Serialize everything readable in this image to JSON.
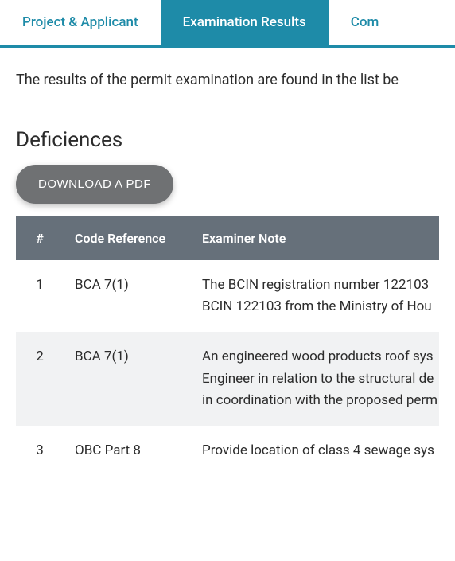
{
  "tabs": {
    "items": [
      {
        "label": "Project & Applicant",
        "active": false
      },
      {
        "label": "Examination Results",
        "active": true
      },
      {
        "label": "Com",
        "active": false
      }
    ]
  },
  "intro_text": "The results of the permit examination are found in the list be",
  "section_title": "Deficiences",
  "download_button_label": "DOWNLOAD A PDF",
  "table": {
    "headers": {
      "num": "#",
      "code": "Code Reference",
      "note": "Examiner Note"
    },
    "rows": [
      {
        "num": "1",
        "code": "BCA 7(1)",
        "note_lines": [
          "The BCIN registration number 122103",
          "BCIN 122103 from the Ministry of Hou"
        ]
      },
      {
        "num": "2",
        "code": "BCA 7(1)",
        "note_lines": [
          "An engineered wood products roof sys",
          "Engineer in relation to the structural de",
          "in coordination with the proposed perm"
        ]
      },
      {
        "num": "3",
        "code": "OBC Part 8",
        "note_lines": [
          "Provide location of class 4 sewage sys"
        ]
      }
    ]
  },
  "colors": {
    "accent": "#1e8ba8",
    "header_bg": "#66707a",
    "button_bg": "#6f7173"
  }
}
